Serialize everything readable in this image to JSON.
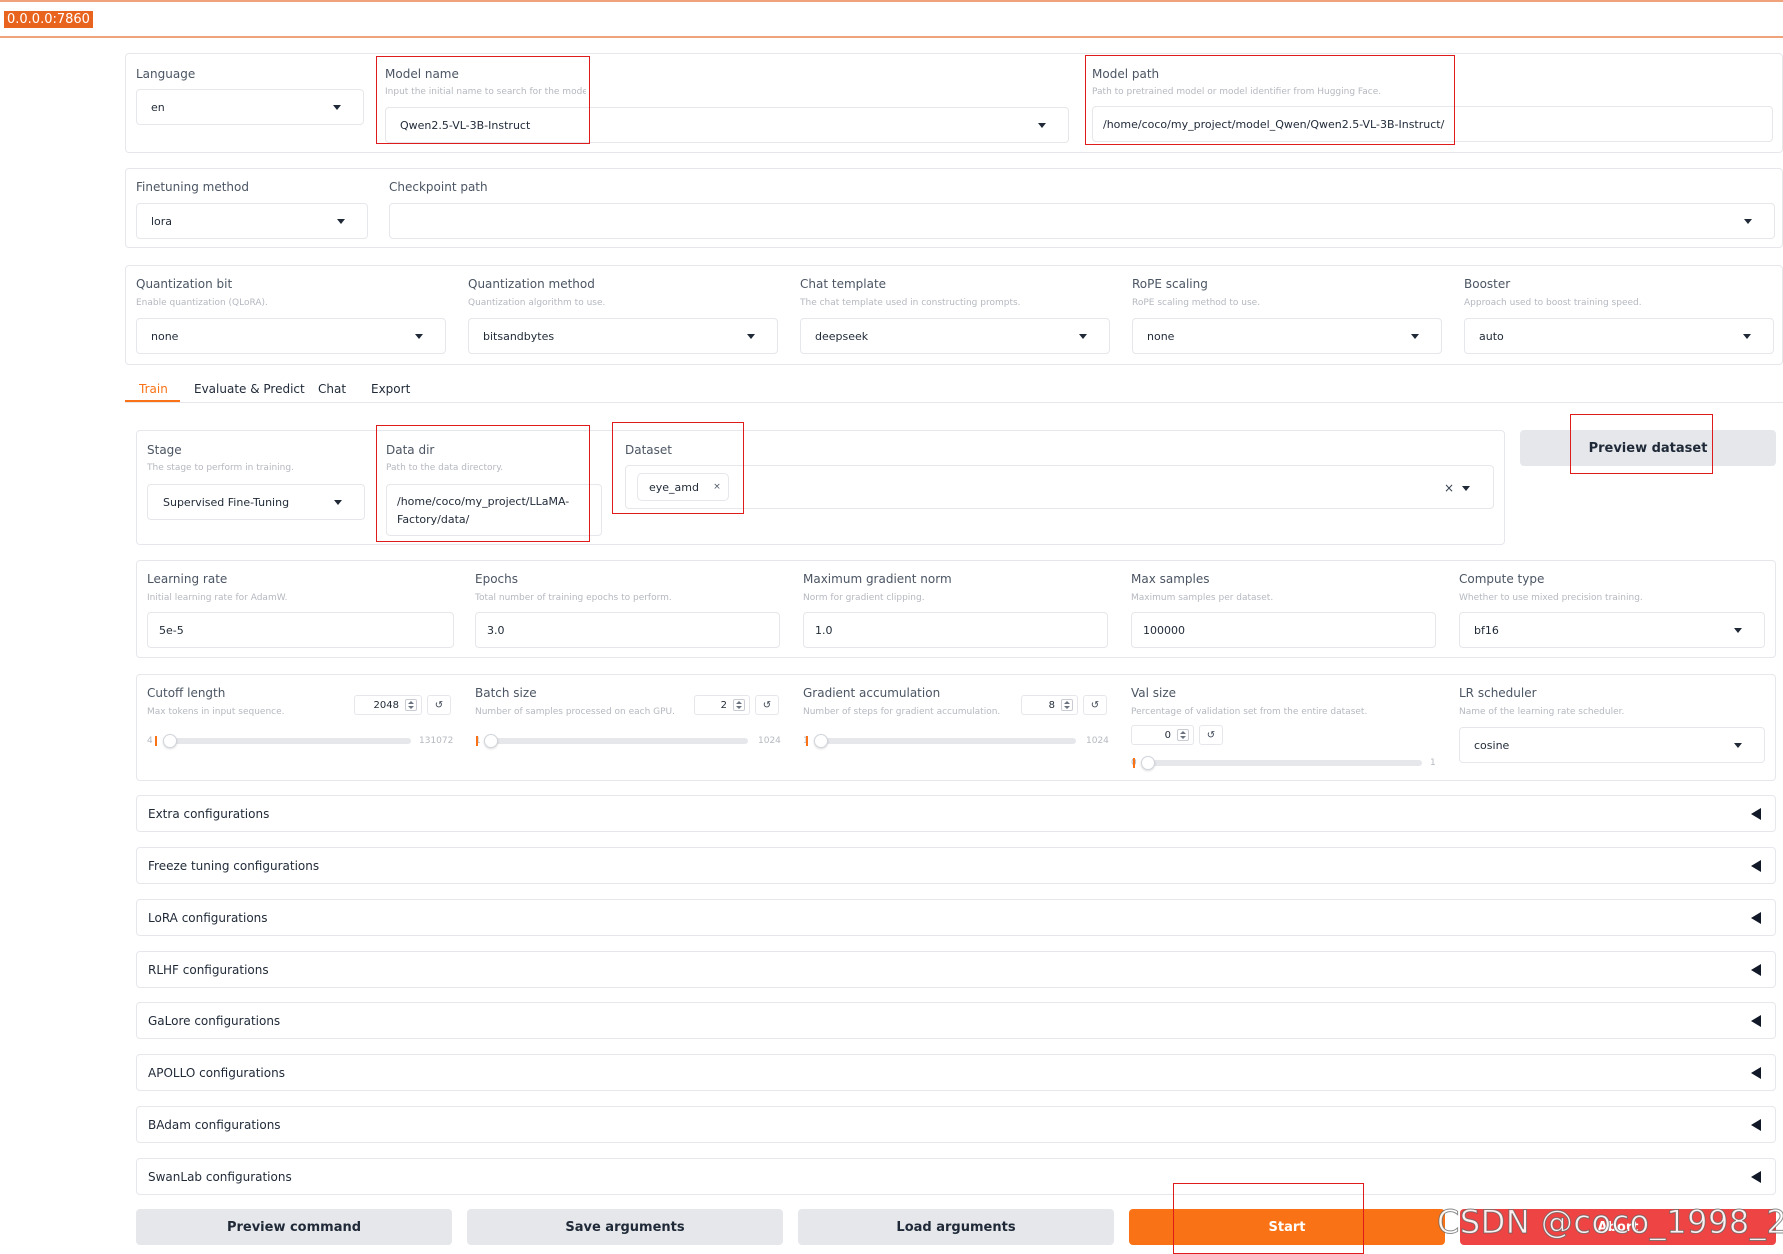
{
  "browser": {
    "url": "0.0.0.0:7860"
  },
  "top": {
    "language": {
      "label": "Language",
      "value": "en"
    },
    "model_name": {
      "label": "Model name",
      "info": "Input the initial name to search for the model.",
      "value": "Qwen2.5-VL-3B-Instruct"
    },
    "model_path": {
      "label": "Model path",
      "info": "Path to pretrained model or model identifier from Hugging Face.",
      "value": "/home/coco/my_project/model_Qwen/Qwen2.5-VL-3B-Instruct/"
    },
    "finetuning_method": {
      "label": "Finetuning method",
      "value": "lora"
    },
    "checkpoint_path": {
      "label": "Checkpoint path",
      "value": ""
    },
    "quantization_bit": {
      "label": "Quantization bit",
      "info": "Enable quantization (QLoRA).",
      "value": "none"
    },
    "quantization_method": {
      "label": "Quantization method",
      "info": "Quantization algorithm to use.",
      "value": "bitsandbytes"
    },
    "chat_template": {
      "label": "Chat template",
      "info": "The chat template used in constructing prompts.",
      "value": "deepseek"
    },
    "rope_scaling": {
      "label": "RoPE scaling",
      "info": "RoPE scaling method to use.",
      "value": "none"
    },
    "booster": {
      "label": "Booster",
      "info": "Approach used to boost training speed.",
      "value": "auto"
    }
  },
  "tabs": [
    "Train",
    "Evaluate & Predict",
    "Chat",
    "Export"
  ],
  "train": {
    "stage": {
      "label": "Stage",
      "info": "The stage to perform in training.",
      "value": "Supervised Fine-Tuning"
    },
    "data_dir": {
      "label": "Data dir",
      "info": "Path to the data directory.",
      "line1": "/home/coco/my_project/LLaMA-",
      "line2": "Factory/data/"
    },
    "dataset": {
      "label": "Dataset",
      "chip": "eye_amd",
      "chip_x": "×",
      "clear": "×"
    },
    "preview_dataset": "Preview dataset",
    "learning_rate": {
      "label": "Learning rate",
      "info": "Initial learning rate for AdamW.",
      "value": "5e-5"
    },
    "epochs": {
      "label": "Epochs",
      "info": "Total number of training epochs to perform.",
      "value": "3.0"
    },
    "max_grad_norm": {
      "label": "Maximum gradient norm",
      "info": "Norm for gradient clipping.",
      "value": "1.0"
    },
    "max_samples": {
      "label": "Max samples",
      "info": "Maximum samples per dataset.",
      "value": "100000"
    },
    "compute_type": {
      "label": "Compute type",
      "info": "Whether to use mixed precision training.",
      "value": "bf16"
    },
    "cutoff_len": {
      "label": "Cutoff length",
      "info": "Max tokens in input sequence.",
      "value": "2048",
      "min": "4",
      "max": "131072",
      "fraction": 0.0156
    },
    "batch_size": {
      "label": "Batch size",
      "info": "Number of samples processed on each GPU.",
      "value": "2",
      "min": "1",
      "max": "1024",
      "fraction": 0.001
    },
    "grad_accum": {
      "label": "Gradient accumulation",
      "info": "Number of steps for gradient accumulation.",
      "value": "8",
      "min": "1",
      "max": "1024",
      "fraction": 0.0068
    },
    "val_size": {
      "label": "Val size",
      "info": "Percentage of validation set from the entire dataset.",
      "value": "0",
      "min": "0",
      "max": "1",
      "fraction": 0
    },
    "lr_scheduler": {
      "label": "LR scheduler",
      "info": "Name of the learning rate scheduler.",
      "value": "cosine"
    },
    "reset_glyph": "↺"
  },
  "accordions": [
    "Extra configurations",
    "Freeze tuning configurations",
    "LoRA configurations",
    "RLHF configurations",
    "GaLore configurations",
    "APOLLO configurations",
    "BAdam configurations",
    "SwanLab configurations"
  ],
  "buttons": {
    "preview_command": "Preview command",
    "save_arguments": "Save arguments",
    "load_arguments": "Load arguments",
    "start": "Start",
    "abort": "Abort"
  },
  "watermark": "CSDN @coco_1998_2",
  "colors": {
    "accent": "#f97316",
    "annotation": "#e01b1b",
    "url_bg": "#e8641e"
  }
}
